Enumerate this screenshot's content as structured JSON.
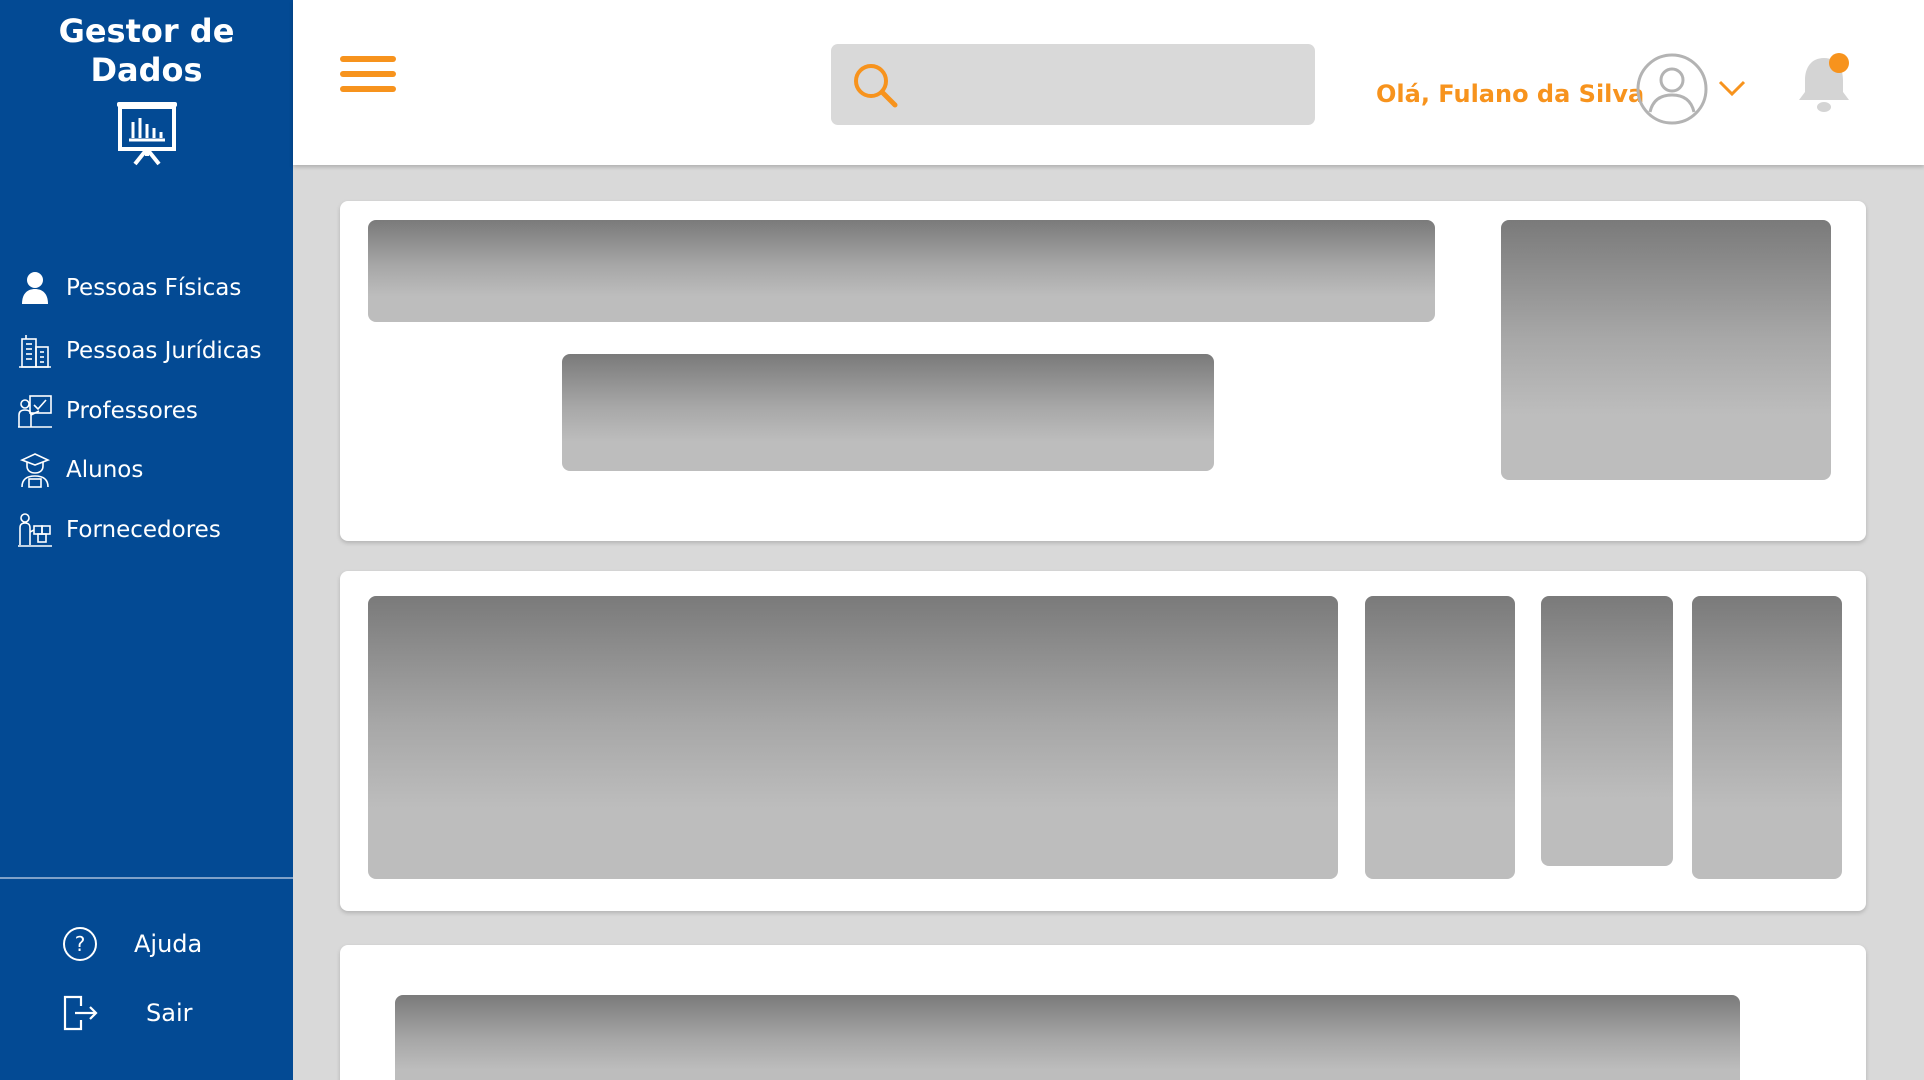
{
  "brand": {
    "title": "Gestor de\nDados"
  },
  "nav": [
    {
      "label": "Pessoas Físicas",
      "icon": "person-icon"
    },
    {
      "label": "Pessoas Jurídicas",
      "icon": "building-icon"
    },
    {
      "label": "Professores",
      "icon": "teacher-board-icon"
    },
    {
      "label": "Alunos",
      "icon": "student-icon"
    },
    {
      "label": "Fornecedores",
      "icon": "supplier-icon"
    }
  ],
  "bottom": {
    "help_label": "Ajuda",
    "logout_label": "Sair"
  },
  "header": {
    "search_placeholder": "",
    "greeting": "Olá, Fulano da Silva"
  },
  "colors": {
    "sidebar": "#034a94",
    "accent": "#f7931d",
    "notification_dot": "#f7931d",
    "placeholder_dark": "#7a7a7a",
    "placeholder_light": "#bdbdbd"
  }
}
